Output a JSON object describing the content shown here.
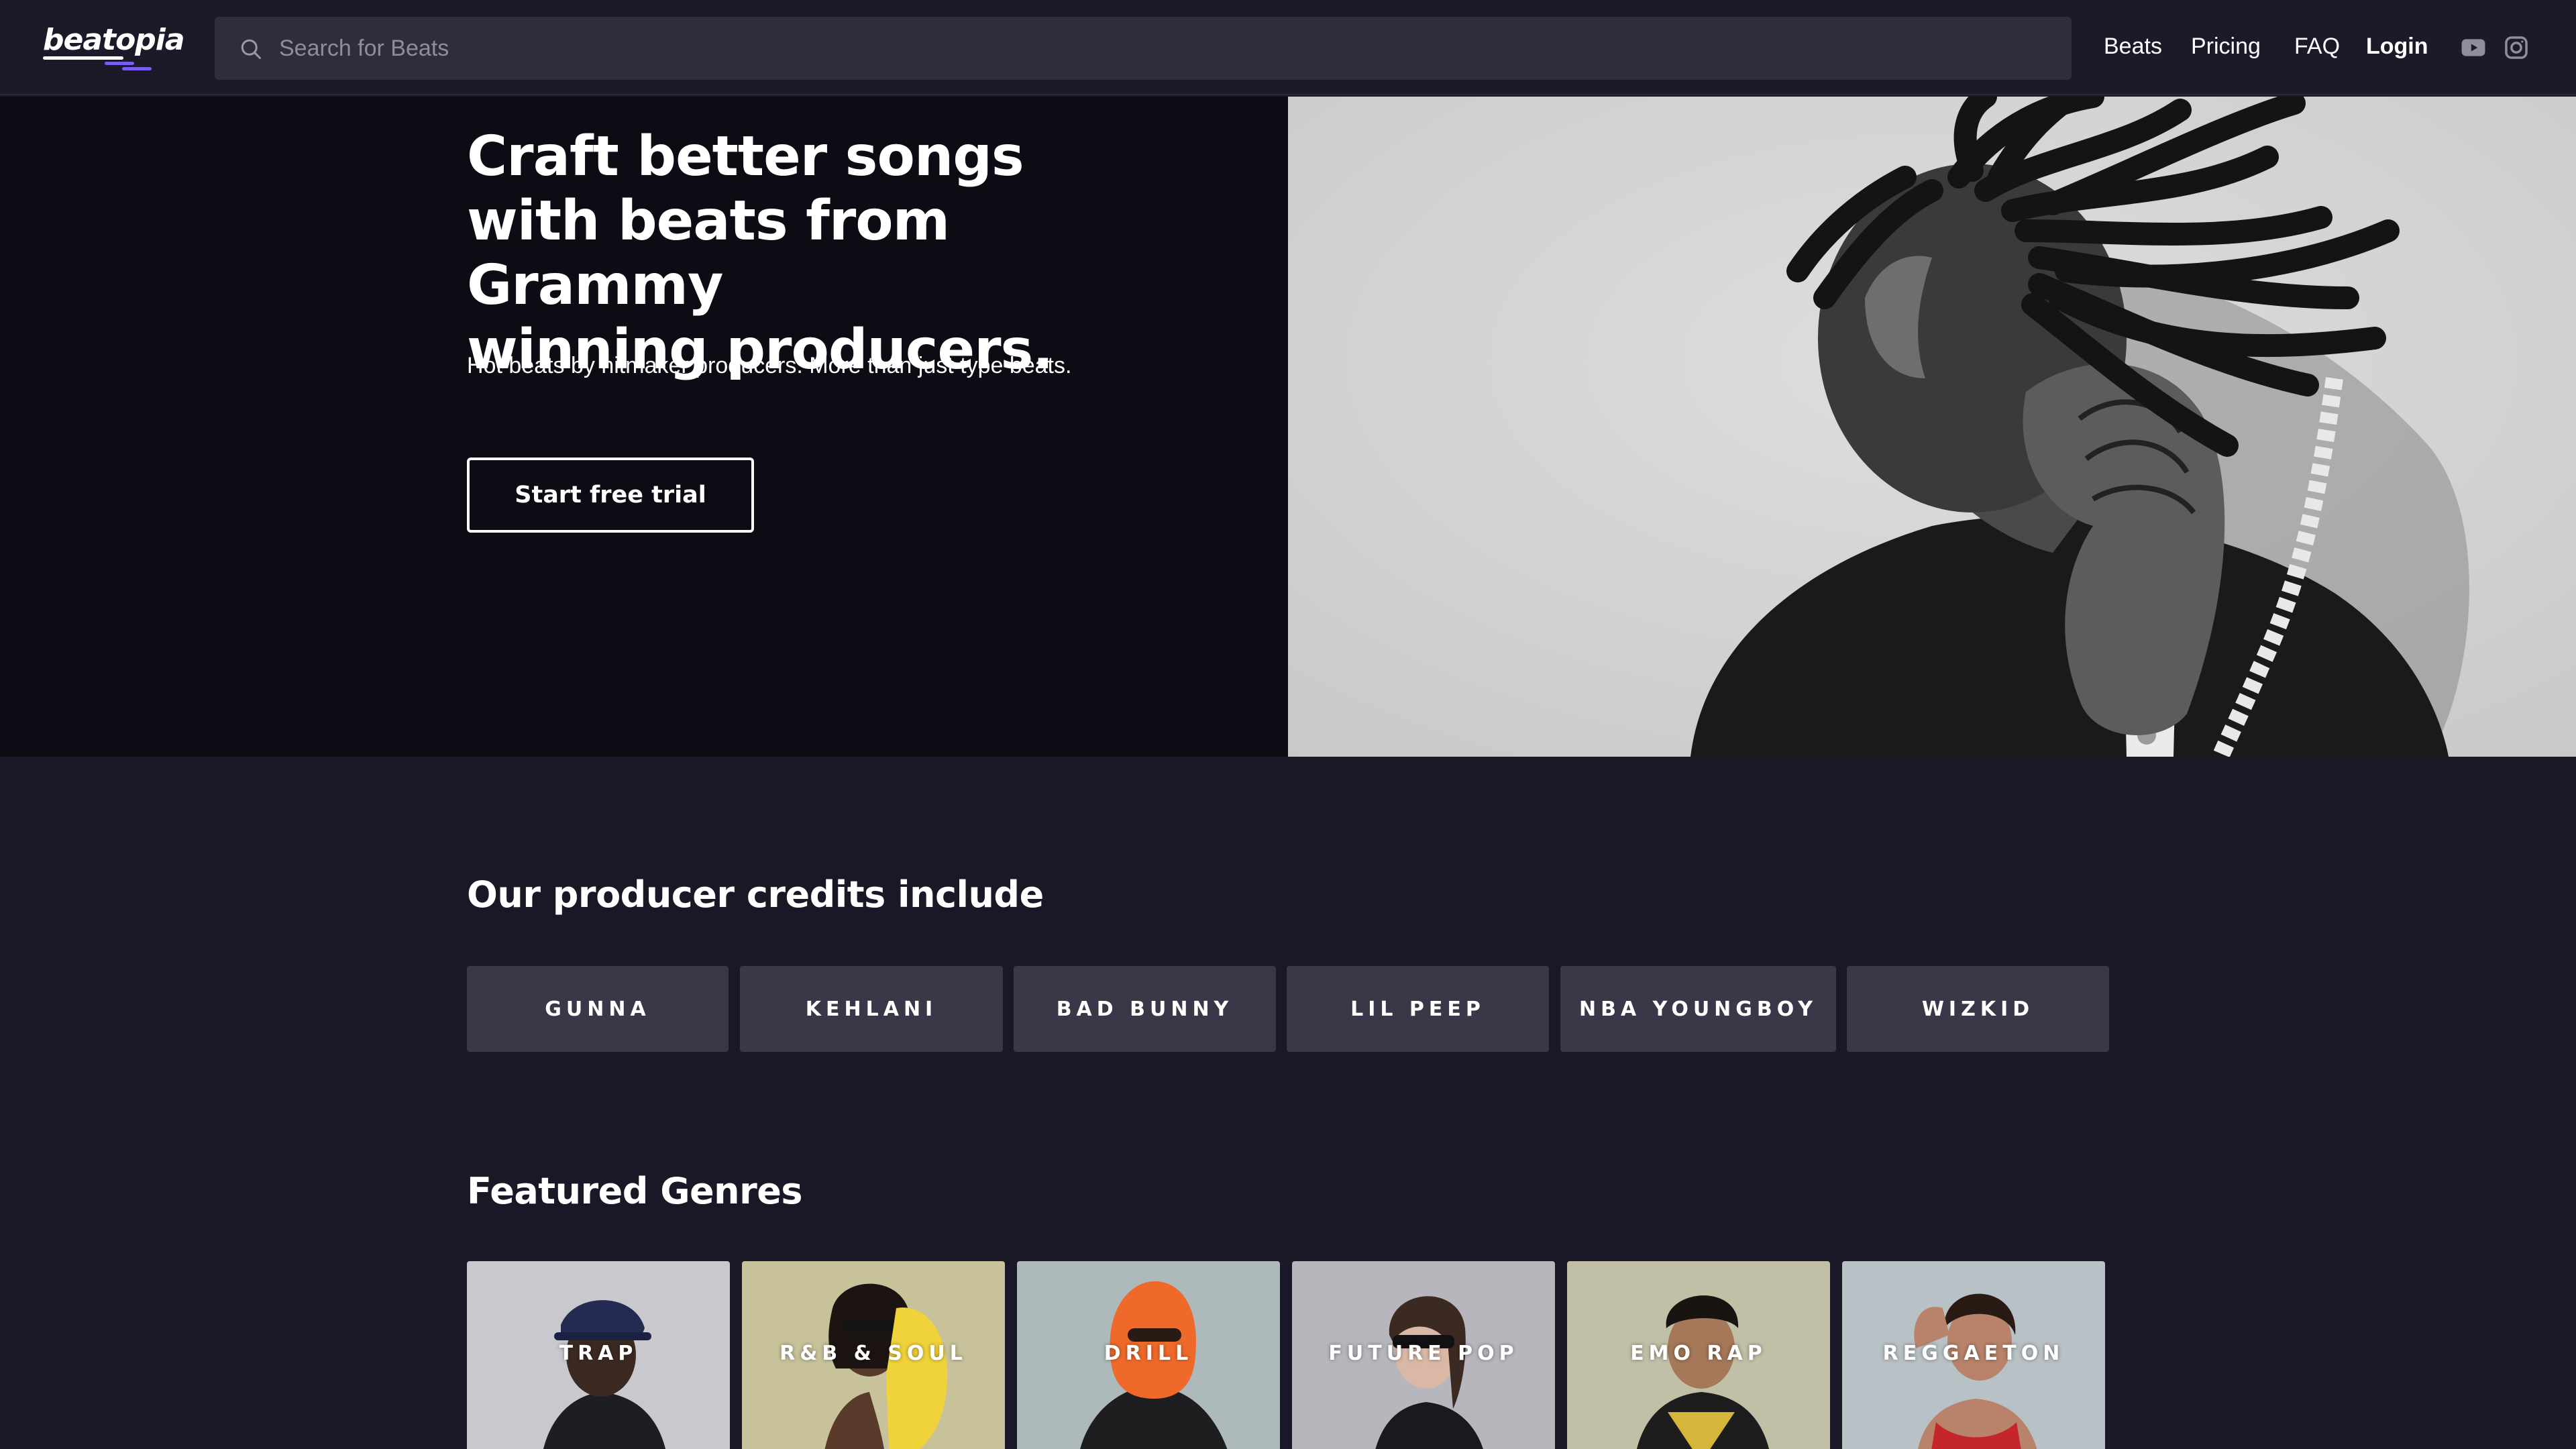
{
  "header": {
    "logo_text": "beatopia",
    "search": {
      "placeholder": "Search for Beats",
      "icon": "search-icon"
    },
    "nav": {
      "beats": "Beats",
      "pricing": "Pricing",
      "faq": "FAQ",
      "login": "Login"
    },
    "social": [
      "youtube-icon",
      "instagram-icon"
    ]
  },
  "hero": {
    "title": "Craft better songs\nwith beats from Grammy\nwinning producers.",
    "subtitle": "Hot beats by hitmaker producers. More than just type beats.",
    "cta_label": "Start free trial",
    "image": "producer-portrait-image"
  },
  "credits": {
    "title": "Our producer credits include",
    "items": [
      "GUNNA",
      "KEHLANI",
      "BAD BUNNY",
      "LIL PEEP",
      "NBA YOUNGBOY",
      "WIZKID"
    ]
  },
  "genres": {
    "title": "Featured Genres",
    "items": [
      {
        "label": "TRAP",
        "bg": "#c9c8cf"
      },
      {
        "label": "R&B & SOUL",
        "bg": "#c8c29b"
      },
      {
        "label": "DRILL",
        "bg": "#adb9bb"
      },
      {
        "label": "FUTURE POP",
        "bg": "#b7b6bd"
      },
      {
        "label": "EMO RAP",
        "bg": "#c1bfa6"
      },
      {
        "label": "REGGAETON",
        "bg": "#b8c1c5"
      }
    ]
  },
  "colors": {
    "background": "#1a1827",
    "header": "#1c1a29",
    "hero_left": "#0d0c15",
    "chip": "#3a3848",
    "accent": "#7b5cf0"
  }
}
